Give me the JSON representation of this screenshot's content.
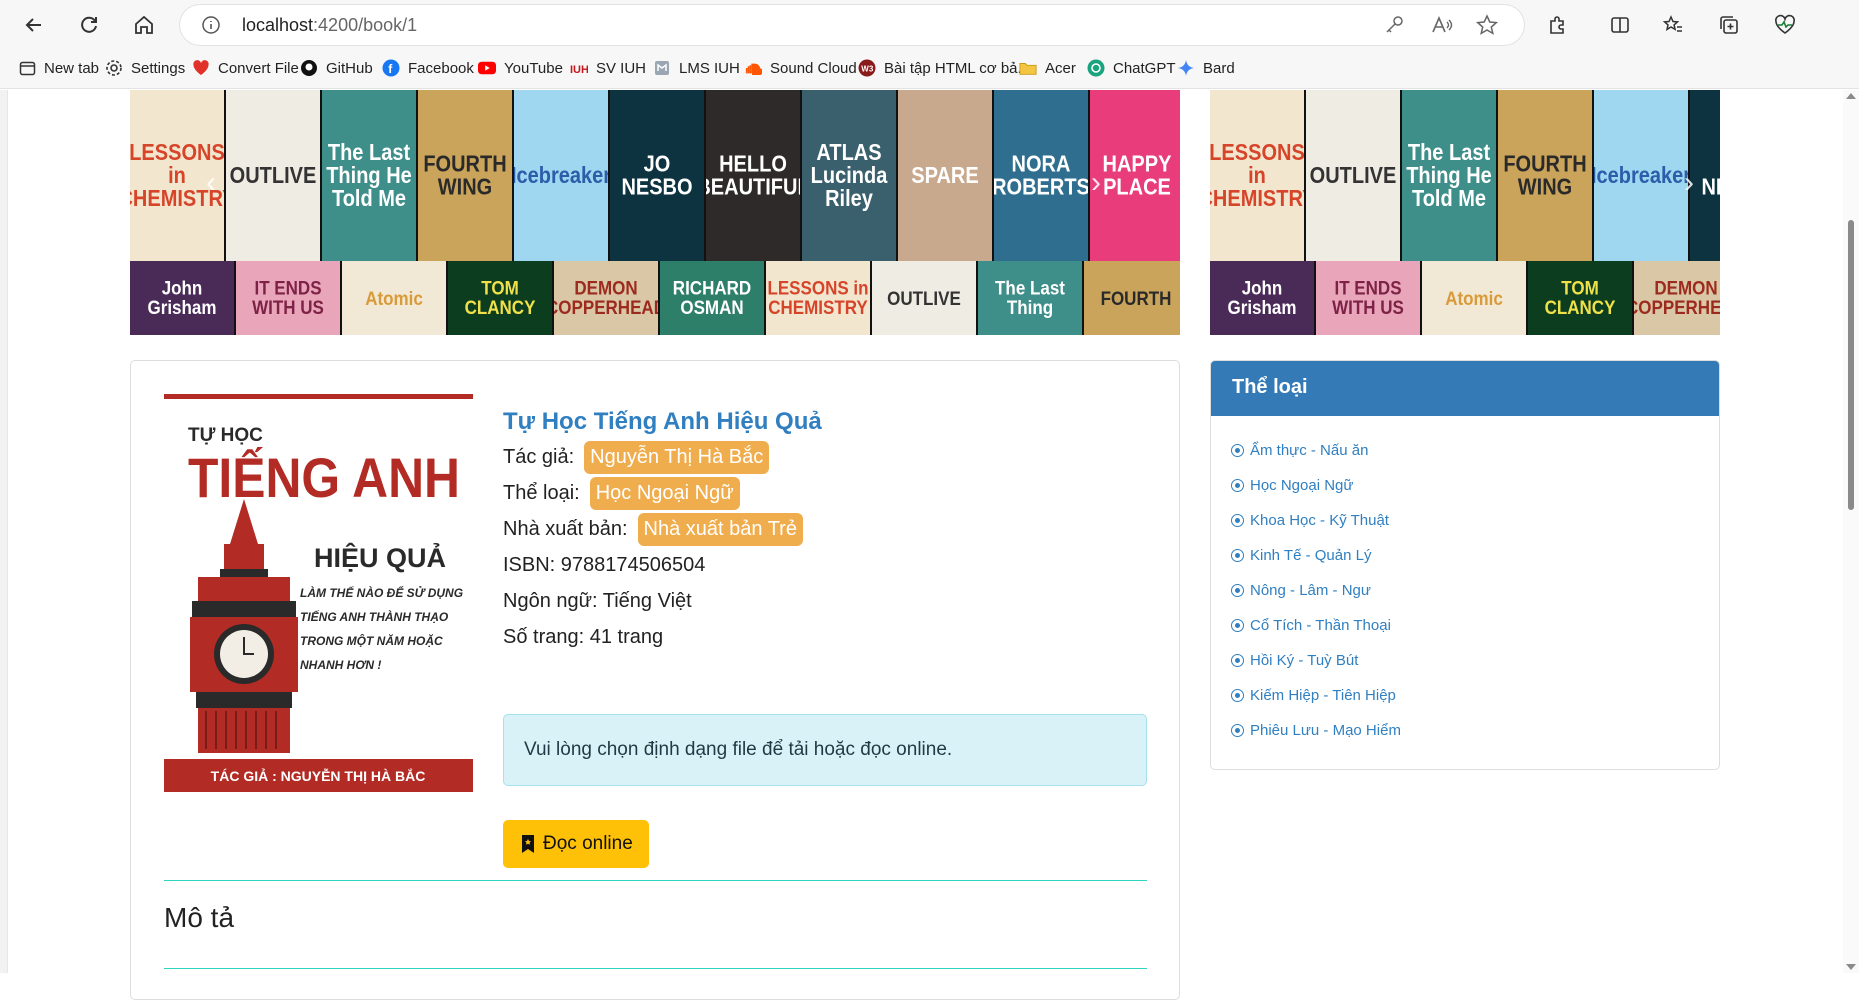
{
  "browser": {
    "url_host": "localhost",
    "url_path": ":4200/book/1"
  },
  "bookmarks": [
    {
      "label": "New tab",
      "icon": "tab-icon"
    },
    {
      "label": "Settings",
      "icon": "gear-icon"
    },
    {
      "label": "Convert File",
      "icon": "heart-icon"
    },
    {
      "label": "GitHub",
      "icon": "github-icon"
    },
    {
      "label": "Facebook",
      "icon": "facebook-icon"
    },
    {
      "label": "YouTube",
      "icon": "youtube-icon"
    },
    {
      "label": "SV IUH",
      "icon": "iuh-icon"
    },
    {
      "label": "LMS IUH",
      "icon": "lms-icon"
    },
    {
      "label": "Sound Cloud",
      "icon": "soundcloud-icon"
    },
    {
      "label": "Bài tập HTML cơ bả...",
      "icon": "site-icon"
    },
    {
      "label": "Acer",
      "icon": "folder-icon"
    },
    {
      "label": "ChatGPT",
      "icon": "chatgpt-icon"
    },
    {
      "label": "Bard",
      "icon": "sparkle-icon"
    }
  ],
  "banner": {
    "covers_top": [
      {
        "text": "LESSONS in CHEMISTRY",
        "bg": "#f3e6cf",
        "fg": "#d6452a"
      },
      {
        "text": "OUTLIVE",
        "bg": "#efece4",
        "fg": "#333333"
      },
      {
        "text": "The Last Thing He Told Me",
        "bg": "#3e8f8a",
        "fg": "#ffffff"
      },
      {
        "text": "FOURTH WING",
        "bg": "#caa45a",
        "fg": "#2a2a2a"
      },
      {
        "text": "Icebreaker",
        "bg": "#9fd6f0",
        "fg": "#2b5da8"
      },
      {
        "text": "JO NESBO",
        "bg": "#0e3340",
        "fg": "#ffffff"
      },
      {
        "text": "HELLO BEAUTIFUL",
        "bg": "#2f2a2a",
        "fg": "#ffffff"
      },
      {
        "text": "ATLAS Lucinda Riley",
        "bg": "#3a5f6d",
        "fg": "#ffffff"
      },
      {
        "text": "SPARE",
        "bg": "#c9a98d",
        "fg": "#ffffff"
      },
      {
        "text": "NORA ROBERTS",
        "bg": "#2f6e8f",
        "fg": "#ffffff"
      },
      {
        "text": "HAPPY PLACE",
        "bg": "#e83d7a",
        "fg": "#ffffff"
      }
    ],
    "covers_bottom": [
      {
        "text": "John Grisham",
        "bg": "#4a2a57",
        "fg": "#ffffff"
      },
      {
        "text": "IT ENDS WITH US",
        "bg": "#e9a5b9",
        "fg": "#7d2246"
      },
      {
        "text": "Atomic",
        "bg": "#f2e8d6",
        "fg": "#d99b3a"
      },
      {
        "text": "TOM CLANCY",
        "bg": "#0b3d1e",
        "fg": "#f0e14a"
      },
      {
        "text": "DEMON COPPERHEAD",
        "bg": "#d9c7a6",
        "fg": "#9c2a1e"
      },
      {
        "text": "RICHARD OSMAN",
        "bg": "#2e7f6a",
        "fg": "#ffffff"
      },
      {
        "text": "LESSONS in CHEMISTRY",
        "bg": "#f3e6cf",
        "fg": "#d6452a"
      },
      {
        "text": "OUTLIVE",
        "bg": "#efece4",
        "fg": "#333333"
      },
      {
        "text": "The Last Thing",
        "bg": "#3e8f8a",
        "fg": "#ffffff"
      },
      {
        "text": "FOURTH",
        "bg": "#caa45a",
        "fg": "#2a2a2a"
      }
    ]
  },
  "book": {
    "cover_line1": "TỰ HỌC",
    "cover_line2": "TIẾNG ANH",
    "cover_line3": "HIỆU QUẢ",
    "cover_blurb": "LÀM THẾ NÀO ĐỂ SỬ DỤNG TIẾNG ANH THÀNH THẠO TRONG MỘT NĂM HOẶC NHANH HƠN !",
    "cover_author": "TÁC GIẢ : NGUYỄN THỊ HÀ BẮC",
    "title": "Tự Học Tiếng Anh Hiệu Quả",
    "author_label": "Tác giả:",
    "author": "Nguyễn Thị Hà Bắc",
    "category_label": "Thể loại:",
    "category": "Học Ngoại Ngữ",
    "publisher_label": "Nhà xuất bản:",
    "publisher": "Nhà xuất bản Trẻ",
    "isbn": "ISBN: 9788174506504",
    "language": "Ngôn ngữ: Tiếng Việt",
    "pages": "Số trang: 41 trang",
    "alert": "Vui lòng chọn định dạng file để tải hoặc đọc online.",
    "read_button": "Đọc online",
    "description_heading": "Mô tả"
  },
  "sidebar": {
    "title": "Thể loại",
    "items": [
      "Ẩm thực - Nấu ăn",
      "Học Ngoại Ngữ",
      "Khoa Học - Kỹ Thuật",
      "Kinh Tế - Quản Lý",
      "Nông - Lâm - Ngư",
      "Cổ Tích - Thần Thoại",
      "Hồi Ký - Tuỳ Bút",
      "Kiếm Hiệp - Tiên Hiệp",
      "Phiêu Lưu - Mạo Hiểm"
    ]
  },
  "colors": {
    "primary": "#337ab7",
    "link": "#2f7fc1",
    "tag": "#f0ad4e",
    "warning_button": "#ffc107",
    "alert_bg": "#d9f2f8",
    "divider": "#2dd4bf"
  }
}
